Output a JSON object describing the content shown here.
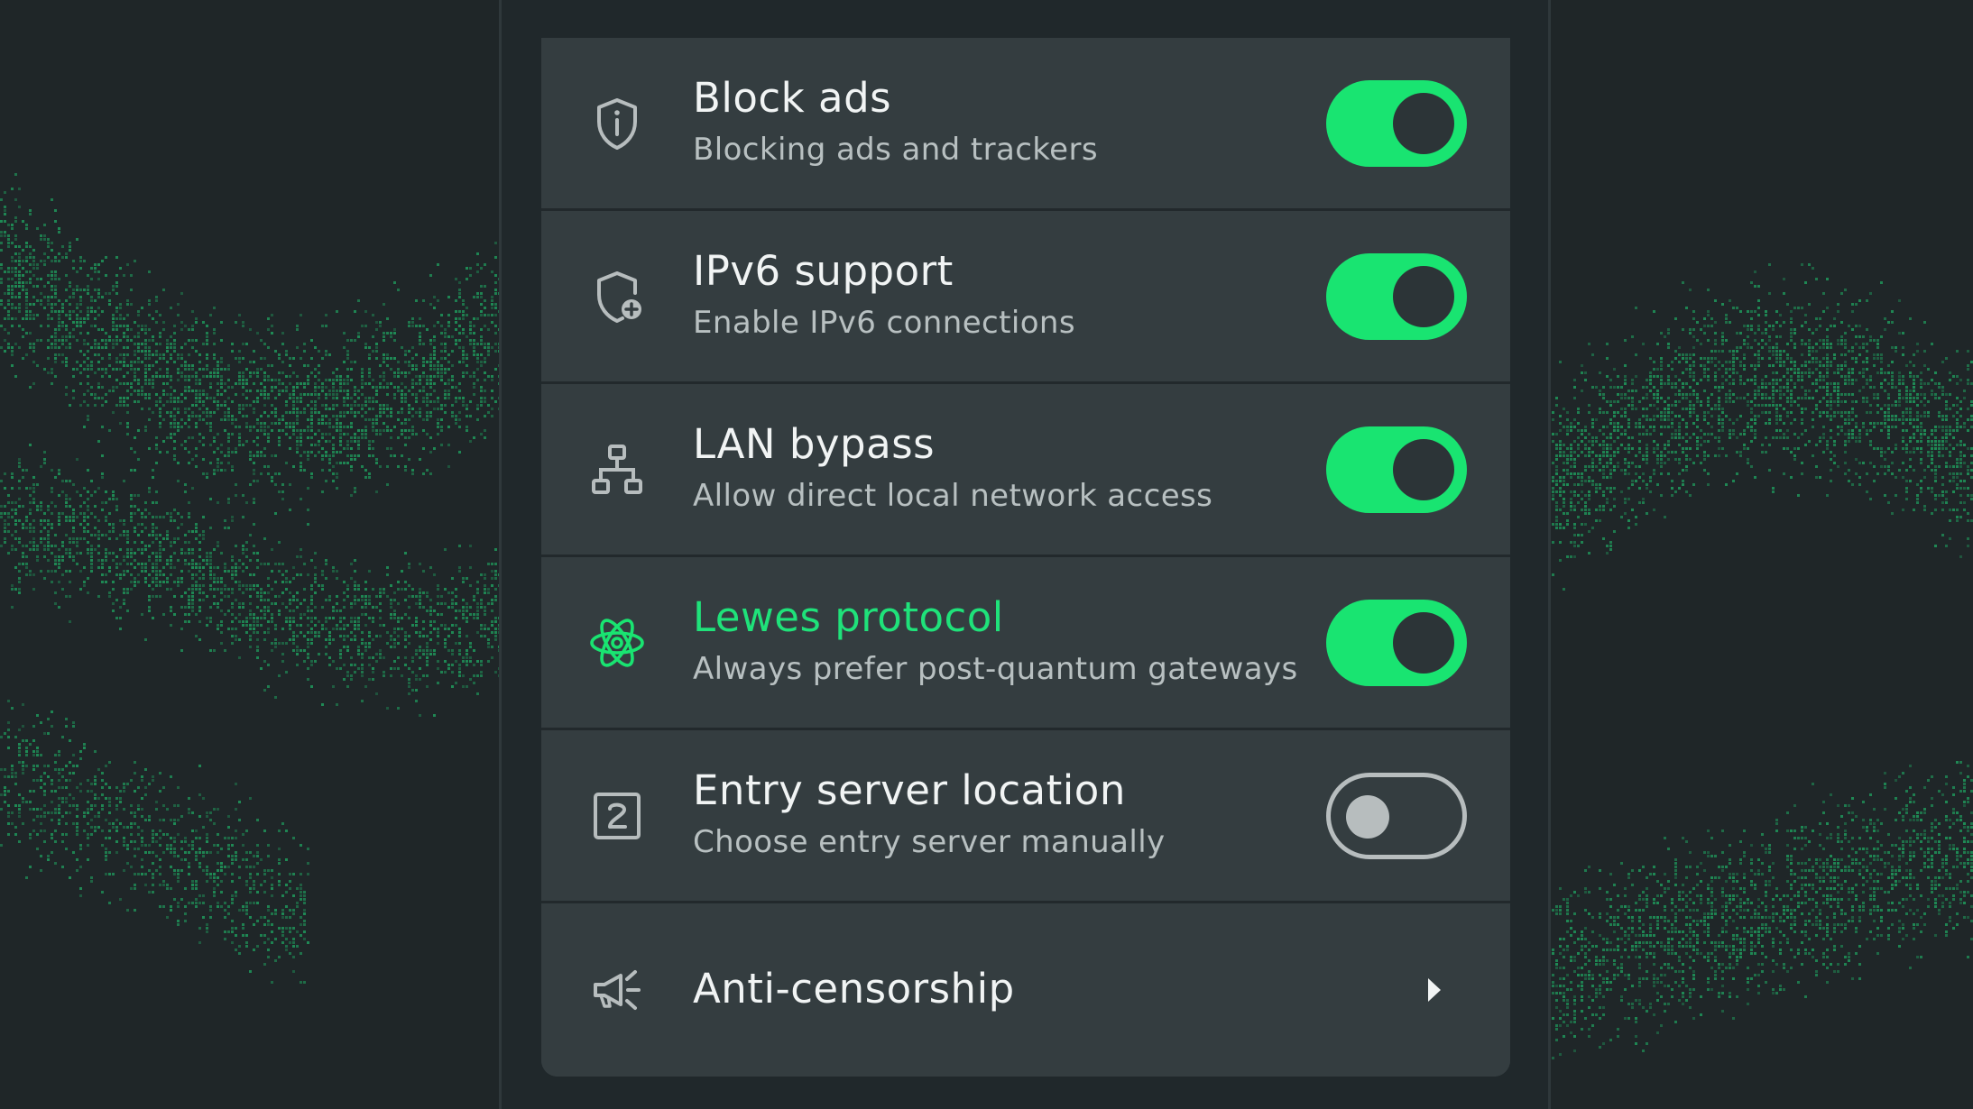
{
  "colors": {
    "background": "#1f2628",
    "panel": "#343d40",
    "accent": "#19e471",
    "text_primary": "#f1f4f4",
    "text_secondary": "#b8c0c1",
    "toggle_off": "#b7bdbe",
    "dots": "#1f8a55"
  },
  "settings": [
    {
      "icon": "shield-info-icon",
      "title": "Block ads",
      "subtitle": "Blocking ads and trackers",
      "control": "toggle",
      "enabled": true
    },
    {
      "icon": "shield-plus-icon",
      "title": "IPv6 support",
      "subtitle": "Enable IPv6 connections",
      "control": "toggle",
      "enabled": true
    },
    {
      "icon": "network-icon",
      "title": "LAN bypass",
      "subtitle": "Allow direct local network access",
      "control": "toggle",
      "enabled": true
    },
    {
      "icon": "atom-icon",
      "title": "Lewes protocol",
      "subtitle": "Always prefer post-quantum gateways",
      "control": "toggle",
      "enabled": true,
      "highlighted": true
    },
    {
      "icon": "entry-server-icon",
      "title": "Entry server location",
      "subtitle": "Choose entry server manually",
      "control": "toggle",
      "enabled": false
    },
    {
      "icon": "megaphone-icon",
      "title": "Anti-censorship",
      "control": "chevron",
      "chevron_icon": "chevron-right-icon"
    }
  ]
}
